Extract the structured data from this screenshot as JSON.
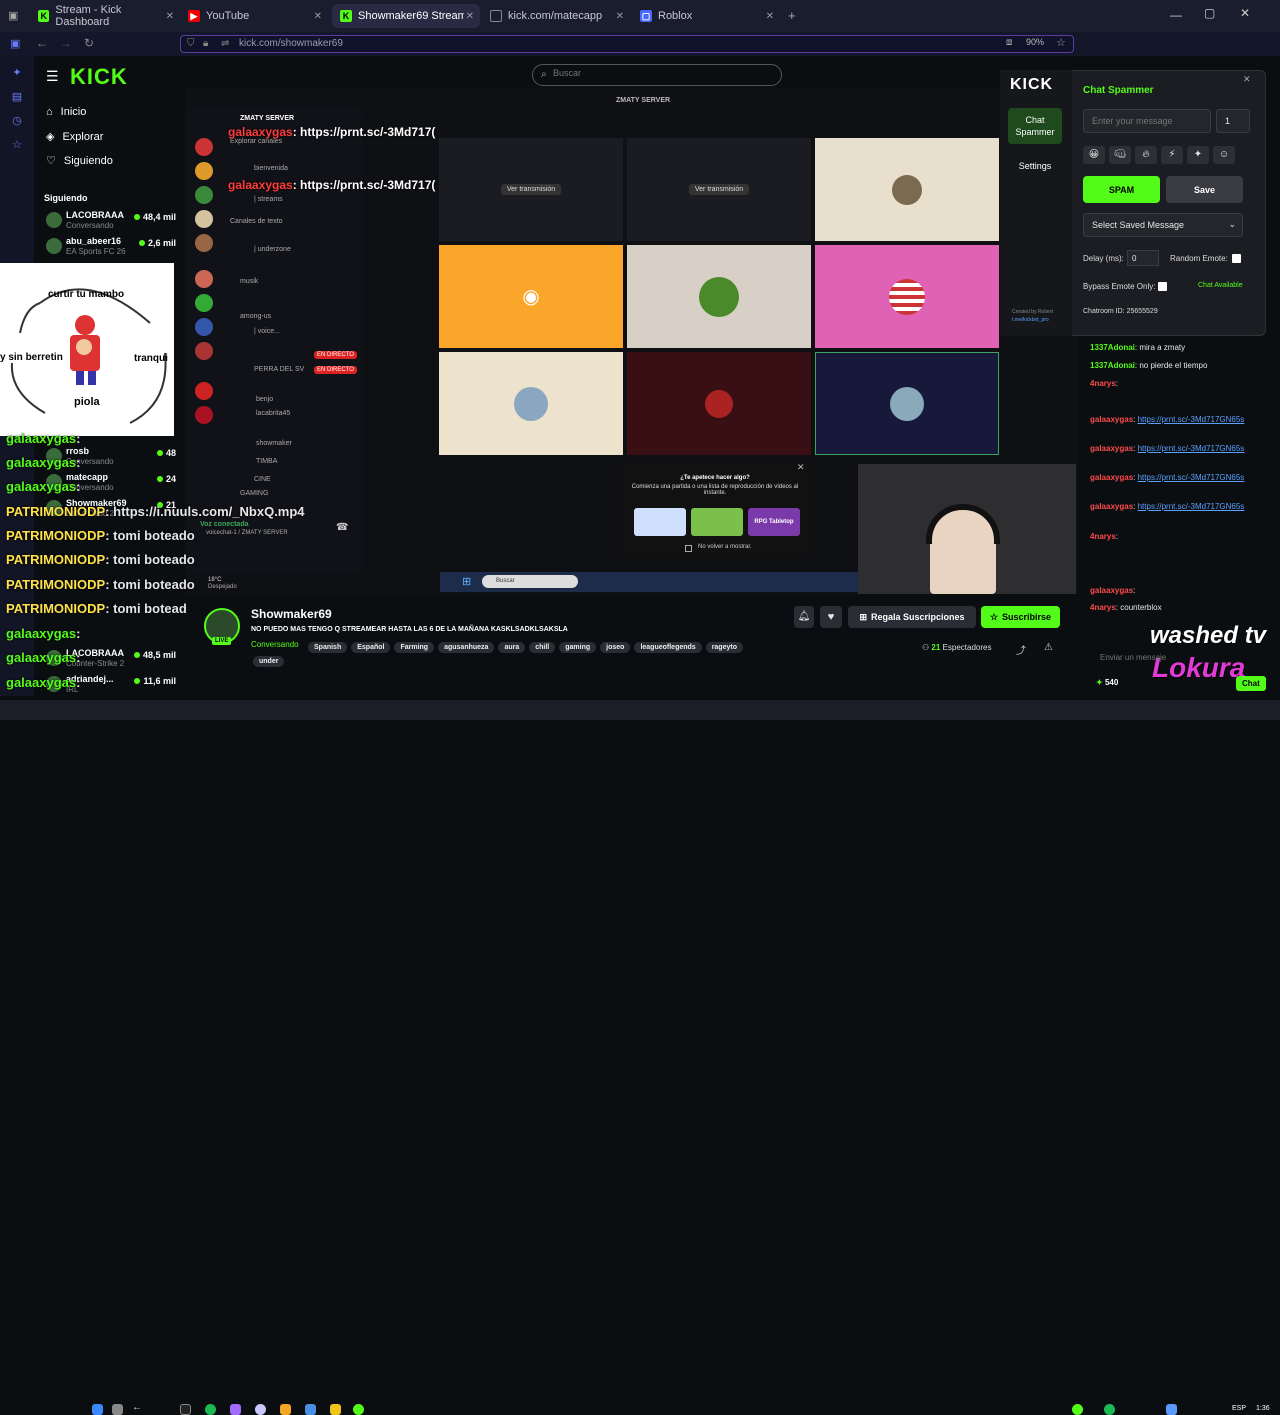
{
  "browser": {
    "tabs": [
      {
        "label": "Stream - Kick Dashboard",
        "icon": "kick-icon"
      },
      {
        "label": "YouTube",
        "icon": "youtube-icon"
      },
      {
        "label": "Showmaker69 Stream - Watch L",
        "icon": "kick-icon"
      },
      {
        "label": "kick.com/matecapp",
        "icon": "page-icon"
      },
      {
        "label": "Roblox",
        "icon": "roblox-icon"
      }
    ],
    "url": "kick.com/showmaker69",
    "zoom": "90%"
  },
  "kick": {
    "logo": "KICK",
    "search_placeholder": "Buscar",
    "nav": [
      {
        "label": "Inicio"
      },
      {
        "label": "Explorar"
      },
      {
        "label": "Siguiendo"
      }
    ],
    "following_title": "Siguiendo",
    "following": [
      {
        "name": "LACOBRAAA",
        "status": "Conversando",
        "viewers": "48,4 mil"
      },
      {
        "name": "abu_abeer16",
        "status": "EA Sports FC 26",
        "viewers": "2,6 mil"
      },
      {
        "name": "rrosb",
        "status": "Conversando",
        "viewers": "48"
      },
      {
        "name": "matecapp",
        "status": "Conversando",
        "viewers": "24"
      },
      {
        "name": "Showmaker69",
        "status": "Left 4 Dead 2",
        "viewers": "21"
      },
      {
        "name": "LACOBRAAA",
        "status": "Counter-Strike 2",
        "viewers": "48,5 mil"
      },
      {
        "name": "adriandej...",
        "status": "IRL",
        "viewers": "11,6 mil"
      }
    ]
  },
  "meme": {
    "top": "curtir tu mambo",
    "left": "y sin berretin",
    "right": "tranqui",
    "bottom": "piola"
  },
  "overlay_chat": [
    {
      "user": "galaaxygas",
      "msg": ":"
    },
    {
      "user": "galaaxygas",
      "msg": ":"
    },
    {
      "user": "galaaxygas",
      "msg": ":"
    },
    {
      "user": "PATRIMONIODP",
      "msg": ": https://i.nuuls.com/_NbxQ.mp4"
    },
    {
      "user": "PATRIMONIODP",
      "msg": ": tomi boteado"
    },
    {
      "user": "PATRIMONIODP",
      "msg": ": tomi boteado"
    },
    {
      "user": "PATRIMONIODP",
      "msg": ": tomi boteado"
    },
    {
      "user": "PATRIMONIODP",
      "msg": ": tomi boteado"
    },
    {
      "user": "galaaxygas",
      "msg": ":"
    },
    {
      "user": "galaaxygas",
      "msg": ":"
    },
    {
      "user": "galaaxygas",
      "msg": ":"
    },
    {
      "user": "galaaxygas",
      "msg": ":"
    }
  ],
  "stream_overlay": {
    "discord_server": "ZMATY SERVER",
    "red_msgs": [
      {
        "user": "galaaxygas",
        "msg": ": https://prnt.sc/-3Md717("
      },
      {
        "user": "galaaxygas",
        "msg": ": https://prnt.sc/-3Md717("
      }
    ],
    "channels": [
      "Explorar canales",
      "bienvenida",
      "| streams",
      "Canales de texto",
      "| underzone",
      "musik",
      "among-us",
      "| voice...",
      "Voz conectada",
      "TIMBA",
      "CINE",
      "GAMING"
    ],
    "members": [
      "PERRA DEL SV",
      "benjo",
      "lacabrita45",
      "showmaker"
    ],
    "live_badge": "EN DIRECTO",
    "view_btn": "Ver transmisión",
    "promo_title": "¿Te apetece hacer algo?",
    "promo_sub": "Comienza una partida o una lista de reproducción de vídeos al instante.",
    "promo_check": "No volver a mostrar.",
    "promo_card": "RPG Tabletop",
    "voice_connected": "Voz conectada",
    "voice_channel": "voicechat-1 / ZMATY SERVER",
    "taskbar_search": "Buscar",
    "temp": "18°C",
    "weather": "Despejado"
  },
  "streamer": {
    "name": "Showmaker69",
    "title": "NO PUEDO MAS TENGO Q STREAMEAR HASTA LAS 6 DE LA MAÑANA KASKLSADKLSAKSLA",
    "category": "Conversando",
    "live": "LIVE",
    "tags": [
      "Spanish",
      "Español",
      "Farming",
      "agusanhueza",
      "aura",
      "chill",
      "gaming",
      "joseo",
      "leagueoflegends",
      "rageyto",
      "under"
    ],
    "gift_label": "Regala Suscripciones",
    "subscribe_label": "Suscribirse",
    "viewers": "21",
    "viewers_label": "Espectadores"
  },
  "spammer": {
    "logo": "KICK",
    "title": "Chat Spammer",
    "tab_chat": "Chat Spammer",
    "tab_settings": "Settings",
    "msg_placeholder": "Enter your message",
    "count": "1",
    "spam": "SPAM",
    "save": "Save",
    "saved_msg": "Select Saved Message",
    "delay_label": "Delay (ms):",
    "delay": "0",
    "random_emote": "Random Emote:",
    "bypass": "Bypass Emote Only:",
    "chat_status": "Chat Available",
    "credit": "Created by Robert",
    "credit2": "t.me/kickbot_pro",
    "chatroom": "Chatroom ID: 25655529"
  },
  "chat": {
    "messages": [
      {
        "user": "1337Adonai",
        "msg": ": mira a zmaty",
        "ucolor": "green"
      },
      {
        "user": "1337Adonai",
        "msg": ": no pierde el tiempo",
        "ucolor": "green"
      },
      {
        "user": "4narys",
        "msg": ":",
        "ucolor": "red"
      },
      {
        "user": "galaaxygas",
        "msg": "https://prnt.sc/-3Md717GN65s",
        "ucolor": "red"
      },
      {
        "user": "galaaxygas",
        "msg": "https://prnt.sc/-3Md717GN65s",
        "ucolor": "red"
      },
      {
        "user": "galaaxygas",
        "msg": "https://prnt.sc/-3Md717GN65s",
        "ucolor": "red"
      },
      {
        "user": "galaaxygas",
        "msg": "https://prnt.sc/-3Md717GN65s",
        "ucolor": "red"
      },
      {
        "user": "4narys",
        "msg": ":",
        "ucolor": "red"
      },
      {
        "user": "galaaxygas",
        "msg": ":",
        "ucolor": "red"
      },
      {
        "user": "4narys",
        "msg": ": counterblox",
        "ucolor": "red"
      }
    ],
    "input_placeholder": "Enviar un mensaje",
    "points": "540",
    "chat_btn": "Chat",
    "overlay1": "washed tv",
    "overlay2": "Lokura"
  },
  "system": {
    "lang": "ESP",
    "time": "1:36"
  }
}
